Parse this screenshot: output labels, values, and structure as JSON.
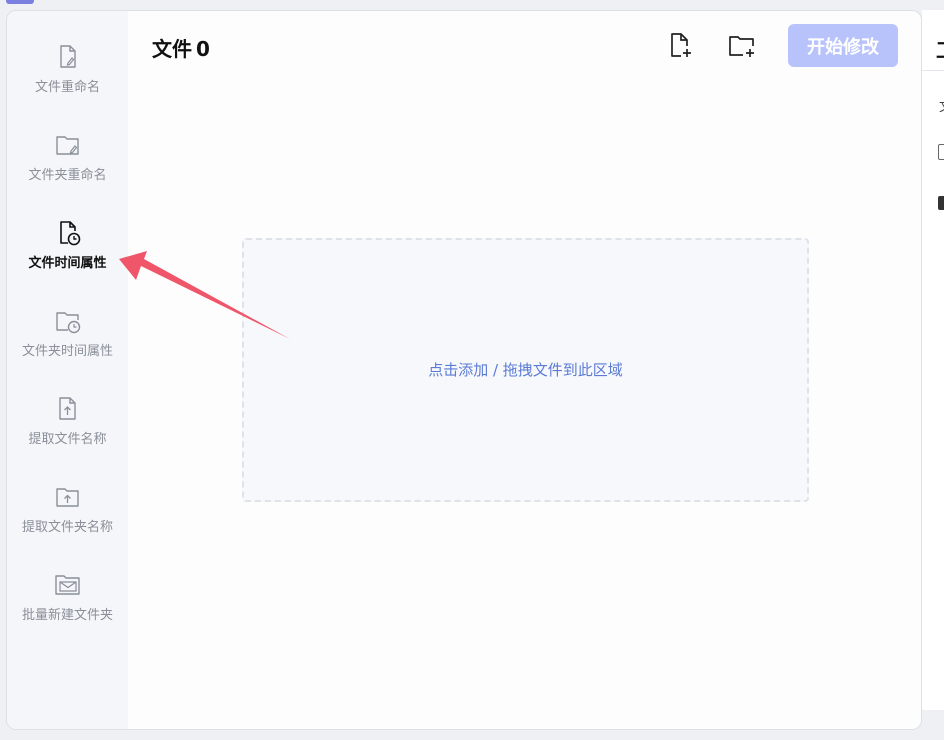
{
  "header": {
    "title": "文件",
    "count": "0"
  },
  "toolbar": {
    "add_file_icon": "file-plus-icon",
    "add_folder_icon": "folder-plus-icon",
    "start_label": "开始修改"
  },
  "sidebar": {
    "items": [
      {
        "label": "文件重命名",
        "icon": "file-edit-icon",
        "active": false
      },
      {
        "label": "文件夹重命名",
        "icon": "folder-edit-icon",
        "active": false
      },
      {
        "label": "文件时间属性",
        "icon": "file-clock-icon",
        "active": true
      },
      {
        "label": "文件夹时间属性",
        "icon": "folder-clock-icon",
        "active": false
      },
      {
        "label": "提取文件名称",
        "icon": "file-upload-icon",
        "active": false
      },
      {
        "label": "提取文件夹名称",
        "icon": "folder-upload-icon",
        "active": false
      },
      {
        "label": "批量新建文件夹",
        "icon": "folder-mail-icon",
        "active": false
      }
    ]
  },
  "dropzone": {
    "hint": "点击添加 / 拖拽文件到此区域"
  },
  "right_panel": {
    "title": "工",
    "text": "文"
  },
  "colors": {
    "accent": "#b8c3fb",
    "hint": "#5b7bd5",
    "arrow": "#f0566a",
    "sidebar_bg": "#f5f6f9"
  },
  "annotation": {
    "type": "red-arrow-pointing-to-active-sidebar-item"
  }
}
